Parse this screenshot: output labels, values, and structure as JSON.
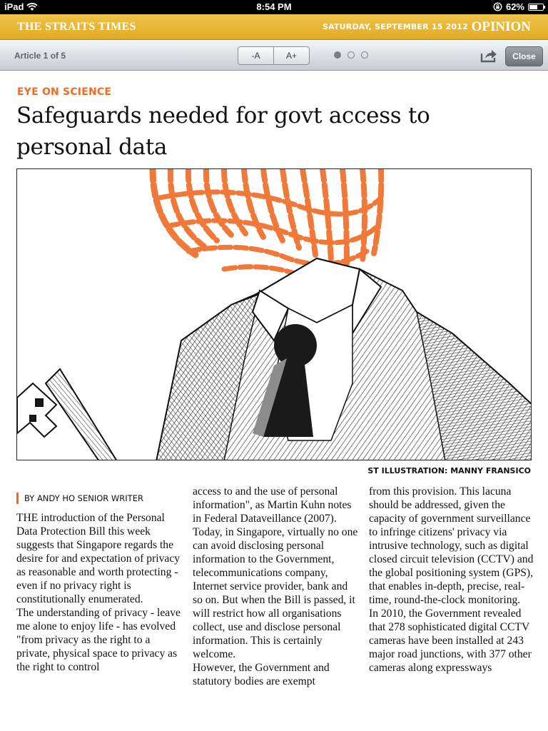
{
  "status_bar": {
    "device": "iPad",
    "time": "8:54 PM",
    "battery": "62%",
    "battery_level": 0.62
  },
  "masthead": {
    "brand": "THE STRAITS TIMES",
    "date": "SATURDAY, SEPTEMBER 15 2012",
    "section": "OPINION",
    "color": "#e2ab24"
  },
  "toolbar": {
    "article_count": "Article 1 of 5",
    "font_decrease": "-A",
    "font_increase": "A+",
    "close_label": "Close",
    "page_dots": 3,
    "active_dot": 1
  },
  "article": {
    "kicker": "EYE ON SCIENCE",
    "headline_line1": "Safeguards needed for govt access to",
    "headline_line2": "personal data",
    "credit": "ST ILLUSTRATION: MANNY FRANSICO",
    "byline": "BY ANDY HO SENIOR WRITER",
    "accent_color": "#f26b21",
    "col1": [
      "THE introduction of the Personal Data Protection Bill this week suggests that Singapore regards the desire for and expectation of privacy as reasonable and worth protecting - even if no privacy right is constitutionally enumerated.",
      " The understanding of privacy - leave me alone to enjoy life - has evolved \"from privacy as the right to a private, physical space to privacy as the right to control"
    ],
    "col2": [
      "access to and the use of personal information\", as Martin Kuhn notes in Federal Dataveillance (2007).",
      " Today, in Singapore, virtually no one can avoid disclosing personal information to the Government, telecommunications company, Internet service provider, bank and so on. But when the Bill is passed, it will restrict how all organisations collect, use and disclose personal information. This is certainly welcome.",
      " However, the Government and statutory bodies are exempt"
    ],
    "col3": [
      "from this provision. This lacuna should be addressed, given the capacity of government surveillance to infringe citizens' privacy via intrusive technology, such as digital closed circuit television (CCTV) and the global positioning system (GPS), that enables in-depth, precise, real-time, round-the-clock monitoring.",
      " In 2010, the Government revealed that 278 sophisticated digital CCTV cameras have been installed at 243 major road junctions, with 377 other cameras along expressways"
    ]
  }
}
